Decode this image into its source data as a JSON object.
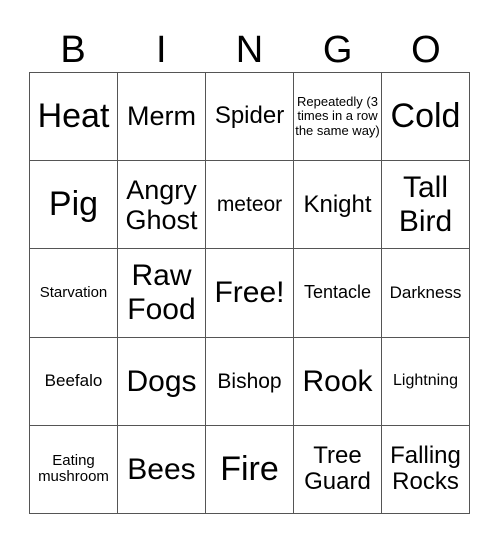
{
  "header": {
    "letters": [
      "B",
      "I",
      "N",
      "G",
      "O"
    ]
  },
  "cells": [
    [
      "Heat",
      "Merm",
      "Spider",
      "Repeatedly (3 times in a row the same way)",
      "Cold"
    ],
    [
      "Pig",
      "Angry Ghost",
      "meteor",
      "Knight",
      "Tall Bird"
    ],
    [
      "Starvation",
      "Raw Food",
      "Free!",
      "Tentacle",
      "Darkness"
    ],
    [
      "Beefalo",
      "Dogs",
      "Bishop",
      "Rook",
      "Lightning"
    ],
    [
      "Eating mushroom",
      "Bees",
      "Fire",
      "Tree Guard",
      "Falling Rocks"
    ]
  ]
}
